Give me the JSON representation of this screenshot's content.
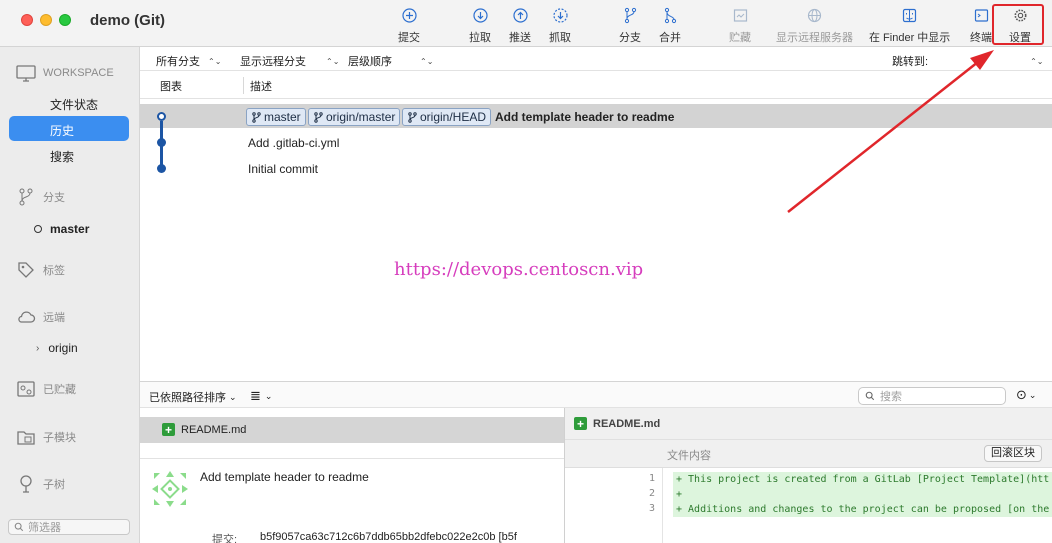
{
  "window": {
    "title": "demo (Git)"
  },
  "toolbar": {
    "commit": "提交",
    "pull": "拉取",
    "push": "推送",
    "fetch": "抓取",
    "branch": "分支",
    "merge": "合并",
    "stash": "贮藏",
    "show_remote": "显示远程服务器",
    "show_finder": "在 Finder 中显示",
    "terminal": "终端",
    "settings": "设置"
  },
  "sidebar": {
    "workspace": "WORKSPACE",
    "file_status": "文件状态",
    "history": "历史",
    "search": "搜索",
    "branches": "分支",
    "branch_master": "master",
    "tags": "标签",
    "remotes": "远端",
    "remote_origin": "origin",
    "stashes": "已贮藏",
    "submodules": "子模块",
    "subtrees": "子树",
    "filter_placeholder": "筛选器"
  },
  "filterbar": {
    "all_branches": "所有分支",
    "show_remote_branches": "显示远程分支",
    "order": "层级顺序",
    "jump_to": "跳转到:"
  },
  "columns": {
    "graph": "图表",
    "description": "描述"
  },
  "commits": [
    {
      "refs": [
        "master",
        "origin/master",
        "origin/HEAD"
      ],
      "message": "Add template header to readme"
    },
    {
      "refs": [],
      "message": "Add .gitlab-ci.yml"
    },
    {
      "refs": [],
      "message": "Initial commit"
    }
  ],
  "watermark": "https://devops.centoscn.vip",
  "bottombar": {
    "sort": "已依照路径排序",
    "search_placeholder": "搜索"
  },
  "files": [
    {
      "name": "README.md"
    }
  ],
  "commit_detail": {
    "message": "Add template header to readme",
    "commit_label": "提交:",
    "hash": "b5f9057ca63c712c6b7ddb65bb2dfebc022e2c0b [b5f"
  },
  "diff": {
    "file": "README.md",
    "section": "文件内容",
    "revert": "回滚区块",
    "lines": [
      {
        "num": "1",
        "text": "+ This project is created from a GitLab [Project Template](htt"
      },
      {
        "num": "2",
        "text": "+"
      },
      {
        "num": "3",
        "text": "+ Additions and changes to the project can be proposed [on the"
      }
    ]
  },
  "colors": {
    "accent": "#3b8ef0",
    "graph": "#1c55a4",
    "added": "#2e9c3a",
    "highlight": "#e0262b"
  }
}
